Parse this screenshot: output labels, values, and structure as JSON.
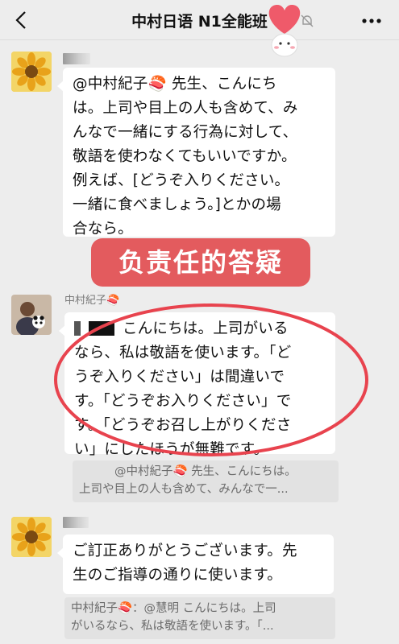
{
  "header": {
    "title": "中村日语 N1全能班",
    "back_icon": "chevron-left-icon",
    "mute_icon": "bell-muted-icon",
    "more_icon": "more-dots-icon"
  },
  "messages": [
    {
      "sender": "",
      "avatar": "sunflower-avatar",
      "lines": [
        "@中村紀子🍣 先生、こんにち",
        "は。上司や目上の人も含めて、み",
        "んなで一緒にする行為に対して、",
        "敬語を使わなくてもいいですか。",
        "例えば、[どうぞ入りください。",
        "一緒に食べましょう。]とかの場",
        "合なら。"
      ]
    },
    {
      "sender": "中村紀子🍣",
      "avatar": "teacher-avatar",
      "lines": [
        "こんにちは。上司がいる",
        "なら、私は敬語を使います。「ど",
        "うぞ入りください」は間違いで",
        "す。「どうぞお入りください」で",
        "す。「どうぞお召し上がりくださ",
        "い」にしたほうが無難です。"
      ],
      "quote": [
        "@中村紀子🍣 先生、こんにちは。",
        "上司や目上の人も含めて、みんなで一..."
      ]
    },
    {
      "sender": "",
      "avatar": "sunflower-avatar",
      "lines": [
        "ご訂正ありがとうございます。先",
        "生のご指導の通りに使います。"
      ],
      "quote": [
        "中村紀子🍣：@慧明 こんにちは。上司",
        "がいるなら、私は敬語を使います。「..."
      ]
    }
  ],
  "banner": {
    "label": "负责任的答疑"
  },
  "colors": {
    "banner": "#e35b5e",
    "highlight_oval": "#e8434e",
    "background": "#ededed"
  }
}
